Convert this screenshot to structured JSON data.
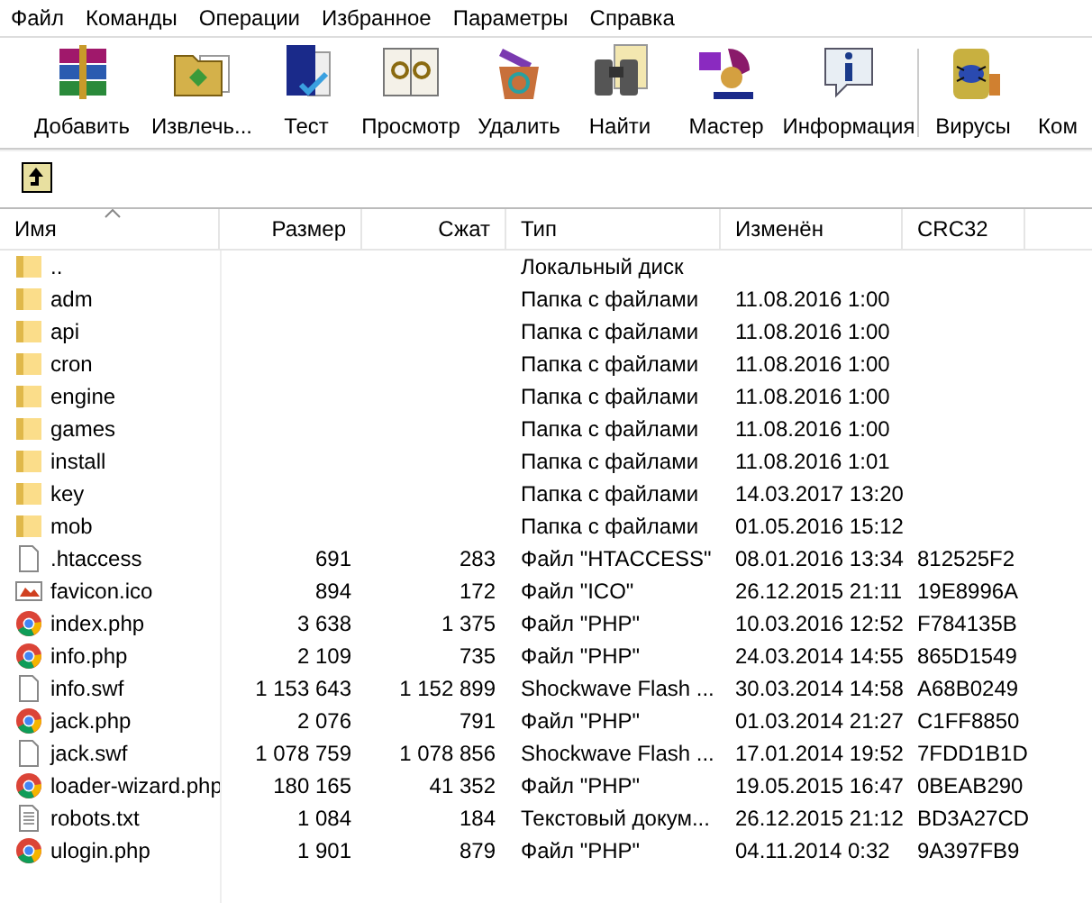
{
  "menu": [
    "Файл",
    "Команды",
    "Операции",
    "Избранное",
    "Параметры",
    "Справка"
  ],
  "toolbar": [
    {
      "label": "Добавить",
      "separator_before": false
    },
    {
      "label": "Извлечь...",
      "separator_before": false
    },
    {
      "label": "Тест",
      "separator_before": false
    },
    {
      "label": "Просмотр",
      "separator_before": false
    },
    {
      "label": "Удалить",
      "separator_before": false
    },
    {
      "label": "Найти",
      "separator_before": false
    },
    {
      "label": "Мастер",
      "separator_before": false
    },
    {
      "label": "Информация",
      "separator_before": false
    },
    {
      "label": "Вирусы",
      "separator_before": true
    },
    {
      "label": "Ком",
      "separator_before": false
    }
  ],
  "table": {
    "columns": [
      {
        "label": "Имя",
        "sorted": true
      },
      {
        "label": "Размер",
        "sorted": false
      },
      {
        "label": "Сжат",
        "sorted": false
      },
      {
        "label": "Тип",
        "sorted": false
      },
      {
        "label": "Изменён",
        "sorted": false
      },
      {
        "label": "CRC32",
        "sorted": false
      }
    ],
    "rows": [
      {
        "kind": "folder",
        "name": "..",
        "type": "Локальный диск"
      },
      {
        "kind": "folder",
        "name": "adm",
        "type": "Папка с файлами",
        "modified": "11.08.2016 1:00"
      },
      {
        "kind": "folder",
        "name": "api",
        "type": "Папка с файлами",
        "modified": "11.08.2016 1:00"
      },
      {
        "kind": "folder",
        "name": "cron",
        "type": "Папка с файлами",
        "modified": "11.08.2016 1:00"
      },
      {
        "kind": "folder",
        "name": "engine",
        "type": "Папка с файлами",
        "modified": "11.08.2016 1:00"
      },
      {
        "kind": "folder",
        "name": "games",
        "type": "Папка с файлами",
        "modified": "11.08.2016 1:00"
      },
      {
        "kind": "folder",
        "name": "install",
        "type": "Папка с файлами",
        "modified": "11.08.2016 1:01"
      },
      {
        "kind": "folder",
        "name": "key",
        "type": "Папка с файлами",
        "modified": "14.03.2017 13:20"
      },
      {
        "kind": "folder",
        "name": "mob",
        "type": "Папка с файлами",
        "modified": "01.05.2016 15:12"
      },
      {
        "kind": "file",
        "name": ".htaccess",
        "size": "691",
        "packed": "283",
        "type": "Файл \"HTACCESS\"",
        "modified": "08.01.2016 13:34",
        "crc": "812525F2"
      },
      {
        "kind": "image",
        "name": "favicon.ico",
        "size": "894",
        "packed": "172",
        "type": "Файл \"ICO\"",
        "modified": "26.12.2015 21:11",
        "crc": "19E8996A"
      },
      {
        "kind": "php",
        "name": "index.php",
        "size": "3 638",
        "packed": "1 375",
        "type": "Файл \"PHP\"",
        "modified": "10.03.2016 12:52",
        "crc": "F784135B"
      },
      {
        "kind": "php",
        "name": "info.php",
        "size": "2 109",
        "packed": "735",
        "type": "Файл \"PHP\"",
        "modified": "24.03.2014 14:55",
        "crc": "865D1549"
      },
      {
        "kind": "file",
        "name": "info.swf",
        "size": "1 153 643",
        "packed": "1 152 899",
        "type": "Shockwave Flash ...",
        "modified": "30.03.2014 14:58",
        "crc": "A68B0249"
      },
      {
        "kind": "php",
        "name": "jack.php",
        "size": "2 076",
        "packed": "791",
        "type": "Файл \"PHP\"",
        "modified": "01.03.2014 21:27",
        "crc": "C1FF8850"
      },
      {
        "kind": "file",
        "name": "jack.swf",
        "size": "1 078 759",
        "packed": "1 078 856",
        "type": "Shockwave Flash ...",
        "modified": "17.01.2014 19:52",
        "crc": "7FDD1B1D"
      },
      {
        "kind": "php",
        "name": "loader-wizard.php",
        "size": "180 165",
        "packed": "41 352",
        "type": "Файл \"PHP\"",
        "modified": "19.05.2015 16:47",
        "crc": "0BEAB290"
      },
      {
        "kind": "text",
        "name": "robots.txt",
        "size": "1 084",
        "packed": "184",
        "type": "Текстовый докум...",
        "modified": "26.12.2015 21:12",
        "crc": "BD3A27CD"
      },
      {
        "kind": "php",
        "name": "ulogin.php",
        "size": "1 901",
        "packed": "879",
        "type": "Файл \"PHP\"",
        "modified": "04.11.2014 0:32",
        "crc": "9A397FB9"
      }
    ]
  }
}
